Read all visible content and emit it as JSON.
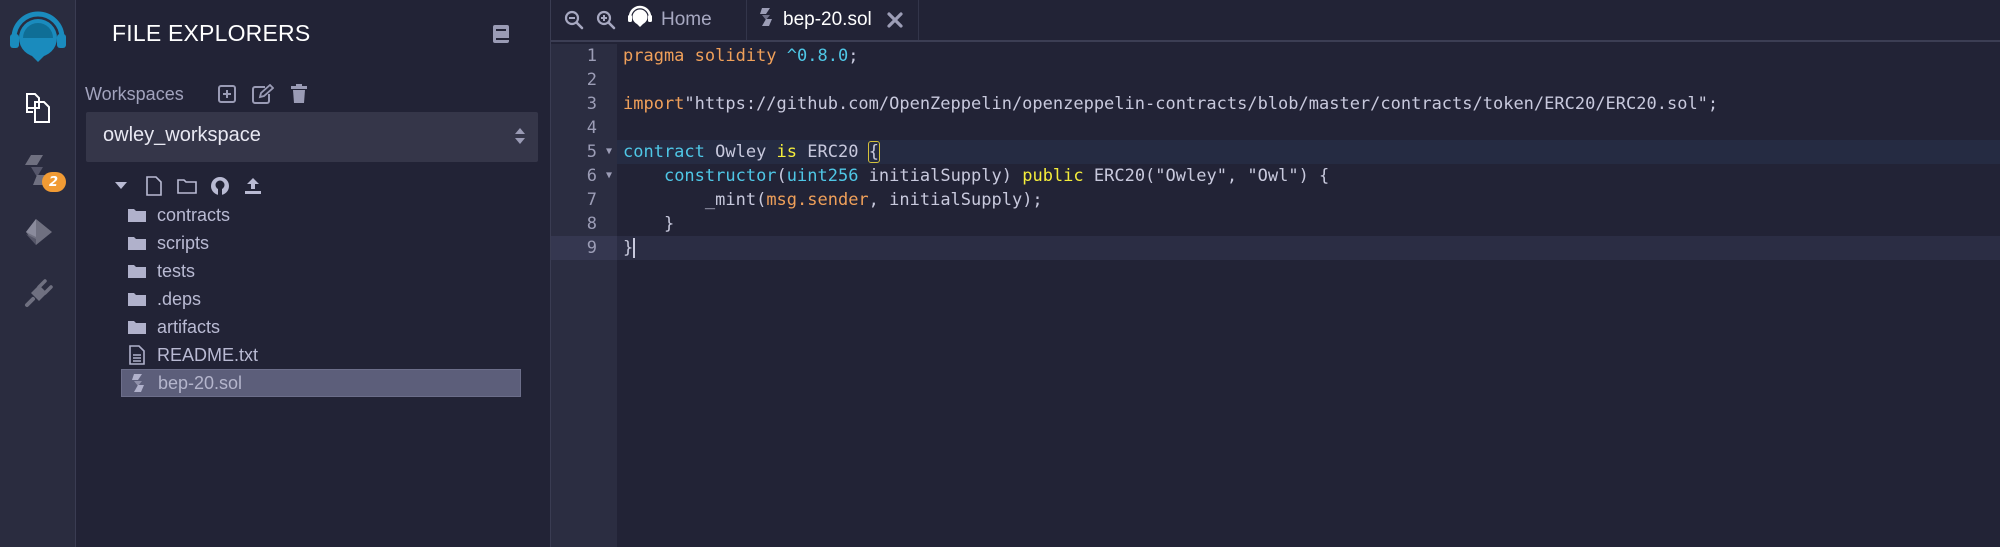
{
  "rail": {
    "items": [
      {
        "name": "file-explorer",
        "icon": "files-icon",
        "active": true
      },
      {
        "name": "solidity-compiler",
        "icon": "solidity-icon",
        "badge": "2"
      },
      {
        "name": "deploy-run",
        "icon": "ethereum-icon"
      },
      {
        "name": "plugin-manager",
        "icon": "plug-icon"
      }
    ],
    "colors": {
      "logo": "#1a8bbd",
      "badge": "#f19b34"
    }
  },
  "explorer": {
    "title": "FILE EXPLORERS",
    "workspaces_label": "Workspaces",
    "workspace_selected": "owley_workspace",
    "tree": [
      {
        "label": "contracts",
        "type": "folder"
      },
      {
        "label": "scripts",
        "type": "folder"
      },
      {
        "label": "tests",
        "type": "folder"
      },
      {
        "label": ".deps",
        "type": "folder"
      },
      {
        "label": "artifacts",
        "type": "folder"
      },
      {
        "label": "README.txt",
        "type": "file"
      },
      {
        "label": "bep-20.sol",
        "type": "solidity",
        "active": true
      }
    ]
  },
  "tabs": {
    "home": "Home",
    "file": "bep-20.sol"
  },
  "editor": {
    "line_numbers": [
      "1",
      "2",
      "3",
      "4",
      "5",
      "6",
      "7",
      "8",
      "9"
    ],
    "code": {
      "l1": {
        "a": "pragma solidity ",
        "b": "^0.8.0",
        "c": ";"
      },
      "l3": {
        "a": "import",
        "b": "\"https://github.com/OpenZeppelin/openzeppelin-contracts/blob/master/contracts/token/ERC20/ERC20.sol\";"
      },
      "l5": {
        "a": "contract",
        "b": " Owley ",
        "c": "is",
        "d": " ERC20 ",
        "e": "{"
      },
      "l6": {
        "indent": "    ",
        "a": "constructor",
        "b": "(",
        "c": "uint256",
        "d": " initialSupply) ",
        "e": "public",
        "f": " ERC20(\"Owley\", \"Owl\") {"
      },
      "l7": {
        "indent": "        ",
        "a": "_mint(",
        "b": "msg.sender",
        "c": ", initialSupply);"
      },
      "l8": {
        "a": "    }"
      },
      "l9": {
        "a": "}"
      }
    }
  }
}
